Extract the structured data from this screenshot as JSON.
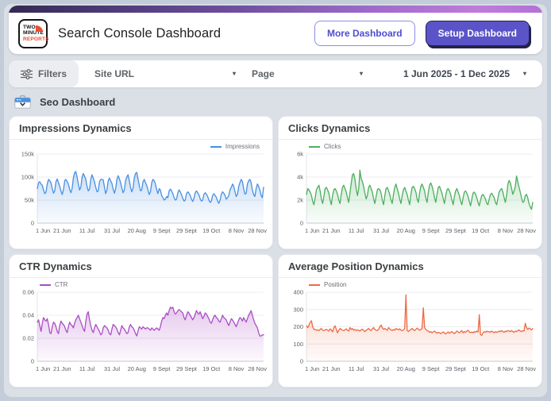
{
  "header": {
    "logo_lines": [
      "TWO",
      "MINUTE",
      "REPORTS"
    ],
    "title": "Search Console Dashboard",
    "more_button": "More Dashboard",
    "setup_button": "Setup Dashboard"
  },
  "filters": {
    "label": "Filters",
    "site_url_label": "Site URL",
    "page_label": "Page",
    "date_range": "1 Jun 2025 - 1 Dec 2025",
    "caret_glyph": "▾"
  },
  "section": {
    "title": "Seo Dashboard"
  },
  "colors": {
    "frame": "#c3ccd9",
    "page_background": "#dbdfe6",
    "header_gradient_start": "#332a52",
    "header_gradient_end": "#b371d6",
    "setup_button": "#5b54c8",
    "more_button_text": "#4d4dd1",
    "logo_accent": "#e8502f",
    "impressions_line": "#4a90e2",
    "clicks_line": "#4caf5f",
    "ctr_line": "#ab4ec4",
    "position_line": "#ed6a45"
  },
  "chart_data": [
    {
      "type": "area",
      "title": "Impressions Dynamics",
      "legend": "Impressions",
      "legend_position": "right",
      "color": "#4a90e2",
      "unit": "thousands (k)",
      "ymax": 150,
      "yticks": [
        {
          "v": 0,
          "label": "0"
        },
        {
          "v": 50,
          "label": "50k"
        },
        {
          "v": 100,
          "label": "100k"
        },
        {
          "v": 150,
          "label": "150k"
        }
      ],
      "xticks": [
        {
          "i": 0,
          "label": "1 Jun"
        },
        {
          "i": 20,
          "label": "21 Jun"
        },
        {
          "i": 40,
          "label": "11 Jul"
        },
        {
          "i": 60,
          "label": "31 Jul"
        },
        {
          "i": 80,
          "label": "20 Aug"
        },
        {
          "i": 100,
          "label": "9 Sept"
        },
        {
          "i": 120,
          "label": "29 Sept"
        },
        {
          "i": 140,
          "label": "19 Oct"
        },
        {
          "i": 160,
          "label": "8 Nov"
        },
        {
          "i": 180,
          "label": "28 Nov"
        }
      ],
      "values": [
        75,
        88,
        90,
        85,
        82,
        72,
        64,
        68,
        85,
        95,
        92,
        88,
        75,
        65,
        70,
        90,
        96,
        88,
        80,
        70,
        62,
        72,
        92,
        95,
        90,
        85,
        74,
        66,
        75,
        98,
        110,
        112,
        100,
        85,
        72,
        78,
        100,
        108,
        102,
        95,
        80,
        70,
        74,
        95,
        105,
        98,
        90,
        78,
        68,
        70,
        90,
        95,
        95,
        94,
        78,
        64,
        72,
        92,
        98,
        92,
        86,
        74,
        65,
        75,
        95,
        103,
        96,
        88,
        76,
        66,
        72,
        93,
        100,
        105,
        92,
        78,
        68,
        76,
        98,
        108,
        110,
        96,
        82,
        70,
        72,
        90,
        95,
        88,
        82,
        72,
        62,
        68,
        88,
        95,
        92,
        85,
        73,
        64,
        75,
        72,
        60,
        55,
        50,
        52,
        58,
        55,
        70,
        74,
        70,
        64,
        55,
        50,
        52,
        66,
        72,
        68,
        62,
        54,
        48,
        50,
        64,
        68,
        65,
        60,
        52,
        47,
        54,
        66,
        70,
        66,
        61,
        53,
        48,
        50,
        62,
        66,
        63,
        58,
        50,
        45,
        48,
        60,
        64,
        60,
        56,
        48,
        43,
        50,
        63,
        68,
        65,
        60,
        52,
        55,
        60,
        72,
        78,
        85,
        80,
        68,
        58,
        62,
        80,
        88,
        95,
        90,
        75,
        63,
        65,
        85,
        92,
        95,
        88,
        72,
        62,
        58,
        75,
        85,
        80,
        72,
        60,
        55,
        78
      ]
    },
    {
      "type": "area",
      "title": "Clicks Dynamics",
      "legend": "Clicks",
      "legend_position": "left",
      "color": "#4caf5f",
      "unit": "thousands (k)",
      "ymax": 6,
      "yticks": [
        {
          "v": 0,
          "label": "0"
        },
        {
          "v": 2,
          "label": "2k"
        },
        {
          "v": 4,
          "label": "4k"
        },
        {
          "v": 6,
          "label": "6k"
        }
      ],
      "xticks": [
        {
          "i": 0,
          "label": "1 Jun"
        },
        {
          "i": 20,
          "label": "21 Jun"
        },
        {
          "i": 40,
          "label": "11 Jul"
        },
        {
          "i": 60,
          "label": "31 Jul"
        },
        {
          "i": 80,
          "label": "20 Aug"
        },
        {
          "i": 100,
          "label": "9 Sept"
        },
        {
          "i": 120,
          "label": "29 Sept"
        },
        {
          "i": 140,
          "label": "19 Oct"
        },
        {
          "i": 160,
          "label": "8 Nov"
        },
        {
          "i": 180,
          "label": "28 Nov"
        }
      ],
      "values": [
        2.5,
        3.0,
        2.9,
        2.7,
        2.4,
        1.9,
        1.6,
        2.2,
        2.9,
        3.1,
        3.3,
        2.8,
        2.1,
        1.7,
        2.3,
        3.0,
        3.1,
        2.9,
        2.6,
        2.0,
        1.6,
        2.4,
        2.9,
        3.0,
        2.8,
        2.5,
        2.0,
        1.7,
        2.5,
        3.1,
        3.3,
        3.0,
        2.7,
        2.2,
        1.8,
        2.6,
        3.5,
        4.2,
        4.3,
        3.8,
        3.0,
        2.4,
        3.0,
        4.6,
        3.9,
        3.6,
        3.2,
        2.6,
        2.1,
        2.4,
        3.1,
        3.3,
        3.0,
        2.7,
        2.1,
        1.7,
        2.3,
        2.9,
        3.0,
        2.9,
        2.6,
        2.0,
        1.6,
        2.4,
        3.0,
        3.1,
        2.8,
        2.5,
        2.0,
        1.7,
        2.5,
        3.1,
        3.4,
        3.0,
        2.6,
        2.1,
        1.7,
        2.4,
        2.9,
        3.1,
        2.8,
        2.5,
        2.0,
        1.6,
        2.5,
        3.1,
        3.2,
        3.0,
        2.7,
        2.1,
        1.8,
        2.6,
        3.2,
        3.4,
        3.1,
        2.8,
        2.2,
        1.8,
        2.7,
        3.3,
        3.5,
        3.2,
        2.8,
        2.2,
        1.8,
        2.5,
        3.1,
        3.2,
        2.9,
        2.6,
        2.1,
        1.7,
        2.4,
        2.9,
        3.0,
        2.8,
        2.5,
        2.0,
        1.6,
        2.3,
        2.8,
        3.0,
        2.7,
        2.4,
        1.9,
        1.6,
        2.2,
        2.7,
        2.8,
        2.6,
        2.3,
        1.9,
        1.5,
        2.1,
        2.6,
        2.7,
        2.5,
        2.2,
        1.8,
        1.5,
        2.0,
        2.4,
        2.5,
        2.3,
        2.1,
        1.7,
        1.6,
        2.1,
        2.5,
        2.6,
        2.4,
        2.2,
        1.8,
        1.6,
        2.2,
        2.7,
        2.9,
        3.0,
        2.7,
        2.2,
        1.8,
        2.4,
        3.4,
        3.7,
        3.5,
        3.0,
        2.5,
        2.8,
        3.2,
        4.1,
        3.6,
        3.1,
        2.7,
        2.2,
        1.8,
        1.9,
        2.4,
        2.5,
        2.2,
        1.7,
        1.4,
        1.2,
        1.8
      ]
    },
    {
      "type": "area",
      "title": "CTR Dynamics",
      "legend": "CTR",
      "legend_position": "left",
      "color": "#ab4ec4",
      "unit": "ratio",
      "ymax": 0.06,
      "yticks": [
        {
          "v": 0,
          "label": "0"
        },
        {
          "v": 0.02,
          "label": "0.02"
        },
        {
          "v": 0.04,
          "label": "0.04"
        },
        {
          "v": 0.06,
          "label": "0.06"
        }
      ],
      "xticks": [
        {
          "i": 0,
          "label": "1 Jun"
        },
        {
          "i": 20,
          "label": "21 Jun"
        },
        {
          "i": 40,
          "label": "11 Jul"
        },
        {
          "i": 60,
          "label": "31 Jul"
        },
        {
          "i": 80,
          "label": "20 Aug"
        },
        {
          "i": 100,
          "label": "9 Sept"
        },
        {
          "i": 120,
          "label": "29 Sept"
        },
        {
          "i": 140,
          "label": "19 Oct"
        },
        {
          "i": 160,
          "label": "8 Nov"
        },
        {
          "i": 180,
          "label": "28 Nov"
        }
      ],
      "values": [
        0.034,
        0.036,
        0.031,
        0.026,
        0.033,
        0.038,
        0.036,
        0.035,
        0.037,
        0.032,
        0.025,
        0.024,
        0.03,
        0.034,
        0.033,
        0.03,
        0.026,
        0.024,
        0.031,
        0.035,
        0.033,
        0.032,
        0.03,
        0.027,
        0.025,
        0.03,
        0.034,
        0.032,
        0.031,
        0.029,
        0.033,
        0.036,
        0.038,
        0.04,
        0.037,
        0.034,
        0.031,
        0.028,
        0.026,
        0.035,
        0.041,
        0.043,
        0.036,
        0.031,
        0.027,
        0.025,
        0.029,
        0.032,
        0.03,
        0.028,
        0.026,
        0.023,
        0.024,
        0.029,
        0.031,
        0.03,
        0.029,
        0.027,
        0.024,
        0.023,
        0.028,
        0.032,
        0.031,
        0.03,
        0.028,
        0.025,
        0.023,
        0.027,
        0.031,
        0.029,
        0.028,
        0.026,
        0.024,
        0.025,
        0.03,
        0.032,
        0.03,
        0.029,
        0.027,
        0.024,
        0.022,
        0.026,
        0.03,
        0.029,
        0.028,
        0.03,
        0.029,
        0.028,
        0.029,
        0.029,
        0.028,
        0.027,
        0.029,
        0.028,
        0.027,
        0.028,
        0.029,
        0.028,
        0.027,
        0.03,
        0.035,
        0.038,
        0.037,
        0.04,
        0.042,
        0.04,
        0.044,
        0.047,
        0.046,
        0.047,
        0.043,
        0.041,
        0.042,
        0.044,
        0.045,
        0.044,
        0.043,
        0.042,
        0.038,
        0.036,
        0.04,
        0.043,
        0.042,
        0.04,
        0.038,
        0.036,
        0.038,
        0.041,
        0.044,
        0.042,
        0.041,
        0.043,
        0.04,
        0.037,
        0.039,
        0.042,
        0.041,
        0.039,
        0.037,
        0.034,
        0.033,
        0.036,
        0.039,
        0.04,
        0.038,
        0.037,
        0.035,
        0.034,
        0.037,
        0.04,
        0.038,
        0.037,
        0.036,
        0.033,
        0.031,
        0.034,
        0.037,
        0.036,
        0.034,
        0.032,
        0.03,
        0.033,
        0.036,
        0.038,
        0.037,
        0.035,
        0.038,
        0.036,
        0.034,
        0.037,
        0.04,
        0.042,
        0.044,
        0.04,
        0.036,
        0.033,
        0.031,
        0.029,
        0.025,
        0.022,
        0.022,
        0.023,
        0.023
      ]
    },
    {
      "type": "area",
      "title": "Average Position Dynamics",
      "legend": "Position",
      "legend_position": "left",
      "color": "#ed6a45",
      "unit": "position",
      "ymax": 400,
      "yticks": [
        {
          "v": 0,
          "label": "0"
        },
        {
          "v": 100,
          "label": "100"
        },
        {
          "v": 200,
          "label": "200"
        },
        {
          "v": 300,
          "label": "300"
        },
        {
          "v": 400,
          "label": "400"
        }
      ],
      "xticks": [
        {
          "i": 0,
          "label": "1 Jun"
        },
        {
          "i": 20,
          "label": "21 Jun"
        },
        {
          "i": 40,
          "label": "11 Jul"
        },
        {
          "i": 60,
          "label": "31 Jul"
        },
        {
          "i": 80,
          "label": "20 Aug"
        },
        {
          "i": 100,
          "label": "9 Sept"
        },
        {
          "i": 120,
          "label": "29 Sept"
        },
        {
          "i": 140,
          "label": "19 Oct"
        },
        {
          "i": 160,
          "label": "8 Nov"
        },
        {
          "i": 180,
          "label": "28 Nov"
        }
      ],
      "values": [
        205,
        195,
        210,
        225,
        235,
        200,
        185,
        185,
        180,
        182,
        178,
        185,
        190,
        180,
        178,
        182,
        185,
        180,
        175,
        188,
        182,
        170,
        195,
        205,
        185,
        165,
        180,
        190,
        185,
        180,
        178,
        182,
        188,
        180,
        175,
        195,
        185,
        190,
        180,
        185,
        178,
        182,
        180,
        175,
        182,
        186,
        178,
        172,
        180,
        185,
        190,
        182,
        178,
        188,
        195,
        185,
        180,
        178,
        185,
        200,
        210,
        195,
        185,
        190,
        185,
        180,
        195,
        188,
        182,
        178,
        185,
        180,
        190,
        186,
        182,
        188,
        180,
        178,
        182,
        190,
        385,
        180,
        172,
        180,
        185,
        190,
        182,
        178,
        185,
        192,
        186,
        180,
        185,
        190,
        310,
        195,
        185,
        178,
        175,
        168,
        172,
        165,
        170,
        175,
        168,
        162,
        168,
        165,
        160,
        165,
        170,
        163,
        158,
        165,
        170,
        162,
        168,
        172,
        165,
        160,
        168,
        175,
        170,
        165,
        172,
        178,
        165,
        172,
        168,
        175,
        180,
        170,
        165,
        170,
        165,
        172,
        168,
        175,
        170,
        270,
        155,
        150,
        165,
        172,
        168,
        175,
        170,
        172,
        168,
        175,
        170,
        165,
        172,
        168,
        170,
        175,
        172,
        178,
        172,
        168,
        175,
        172,
        178,
        175,
        172,
        178,
        172,
        168,
        175,
        172,
        178,
        182,
        175,
        172,
        178,
        175,
        220,
        195,
        185,
        192,
        188,
        182,
        190
      ]
    }
  ]
}
